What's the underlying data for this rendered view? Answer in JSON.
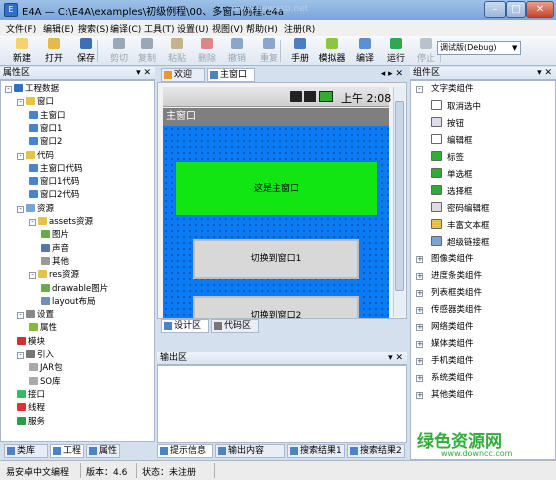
{
  "window": {
    "title": "E4A — C:\\E4A\\examples\\初级例程\\00、多窗口例程.e4a",
    "watermark": "www.newasp.net",
    "app_icon": "E"
  },
  "menu": [
    "文件(F)",
    "编辑(E)",
    "搜索(S)",
    "编译(C)",
    "工具(T)",
    "设置(U)",
    "视图(V)",
    "帮助(H)",
    "注册(R)"
  ],
  "toolbar": [
    {
      "label": "新建",
      "icon": "new-file-icon",
      "color": "#f5d26b",
      "enabled": true
    },
    {
      "label": "打开",
      "icon": "open-folder-icon",
      "color": "#e8b84a",
      "enabled": true
    },
    {
      "label": "保存",
      "icon": "save-icon",
      "color": "#3c6fb5",
      "enabled": true
    },
    {
      "label": "剪切",
      "icon": "cut-icon",
      "color": "#9aa7b8",
      "enabled": false
    },
    {
      "label": "复制",
      "icon": "copy-icon",
      "color": "#9aa7b8",
      "enabled": false
    },
    {
      "label": "粘贴",
      "icon": "paste-icon",
      "color": "#c7b28a",
      "enabled": false
    },
    {
      "label": "删除",
      "icon": "delete-icon",
      "color": "#d88",
      "enabled": false
    },
    {
      "label": "撤销",
      "icon": "undo-icon",
      "color": "#8aa6cf",
      "enabled": false
    },
    {
      "label": "重复",
      "icon": "redo-icon",
      "color": "#8aa6cf",
      "enabled": false
    },
    {
      "label": "手册",
      "icon": "manual-icon",
      "color": "#4a7fc2",
      "enabled": true
    },
    {
      "label": "模拟器",
      "icon": "android-icon",
      "color": "#8cc63f",
      "enabled": true
    },
    {
      "label": "编译",
      "icon": "compile-icon",
      "color": "#5b8fd6",
      "enabled": true
    },
    {
      "label": "运行",
      "icon": "run-icon",
      "color": "#2fa84f",
      "enabled": true
    },
    {
      "label": "停止",
      "icon": "stop-icon",
      "color": "#b9c2cc",
      "enabled": false
    }
  ],
  "debug_mode": "调试版(Debug)",
  "left_panel": {
    "title": "属性区",
    "tabs": [
      "类库",
      "工程",
      "属性"
    ]
  },
  "project_tree": [
    {
      "label": "工程数据",
      "level": 0,
      "icon": "project-icon",
      "exp": "-"
    },
    {
      "label": "窗口",
      "level": 1,
      "icon": "folder-icon",
      "exp": "-"
    },
    {
      "label": "主窗口",
      "level": 2,
      "icon": "window-icon",
      "exp": ""
    },
    {
      "label": "窗口1",
      "level": 2,
      "icon": "window-icon",
      "exp": ""
    },
    {
      "label": "窗口2",
      "level": 2,
      "icon": "window-icon",
      "exp": ""
    },
    {
      "label": "代码",
      "level": 1,
      "icon": "folder-icon",
      "exp": "-"
    },
    {
      "label": "主窗口代码",
      "level": 2,
      "icon": "code-icon",
      "exp": ""
    },
    {
      "label": "窗口1代码",
      "level": 2,
      "icon": "code-icon",
      "exp": ""
    },
    {
      "label": "窗口2代码",
      "level": 2,
      "icon": "code-icon",
      "exp": ""
    },
    {
      "label": "资源",
      "level": 1,
      "icon": "resource-icon",
      "exp": "-"
    },
    {
      "label": "assets资源",
      "level": 2,
      "icon": "folder-icon",
      "exp": "-"
    },
    {
      "label": "图片",
      "level": 3,
      "icon": "image-icon",
      "exp": ""
    },
    {
      "label": "声音",
      "level": 3,
      "icon": "sound-icon",
      "exp": ""
    },
    {
      "label": "其他",
      "level": 3,
      "icon": "other-icon",
      "exp": ""
    },
    {
      "label": "res资源",
      "level": 2,
      "icon": "folder-icon",
      "exp": "-"
    },
    {
      "label": "drawable图片",
      "level": 3,
      "icon": "image-icon",
      "exp": ""
    },
    {
      "label": "layout布局",
      "level": 3,
      "icon": "layout-icon",
      "exp": ""
    },
    {
      "label": "设置",
      "level": 1,
      "icon": "settings-icon",
      "exp": "-"
    },
    {
      "label": "属性",
      "level": 2,
      "icon": "property-icon",
      "exp": ""
    },
    {
      "label": "模块",
      "level": 1,
      "icon": "module-icon",
      "exp": ""
    },
    {
      "label": "引入",
      "level": 1,
      "icon": "import-icon",
      "exp": "-"
    },
    {
      "label": "JAR包",
      "level": 2,
      "icon": "jar-icon",
      "exp": ""
    },
    {
      "label": "SO库",
      "level": 2,
      "icon": "so-icon",
      "exp": ""
    },
    {
      "label": "接口",
      "level": 1,
      "icon": "interface-icon",
      "exp": ""
    },
    {
      "label": "线程",
      "level": 1,
      "icon": "thread-icon",
      "exp": ""
    },
    {
      "label": "服务",
      "level": 1,
      "icon": "service-icon",
      "exp": ""
    }
  ],
  "doc_tabs": [
    "欢迎",
    "主窗口"
  ],
  "phone": {
    "time": "上午 2:08",
    "window_title": "主窗口",
    "label_text": "这是主窗口",
    "btn1": "切换到窗口1",
    "btn2": "切换到窗口2"
  },
  "view_tabs": [
    "设计区",
    "代码区"
  ],
  "output": {
    "title": "输出区",
    "tabs": [
      "提示信息",
      "输出内容",
      "搜索结果1",
      "搜索结果2"
    ]
  },
  "right_panel": {
    "title": "组件区"
  },
  "component_groups": [
    {
      "label": "文字类组件",
      "open": true,
      "items": [
        {
          "label": "取消选中",
          "icon": "cursor-icon"
        },
        {
          "label": "按钮",
          "icon": "button-icon"
        },
        {
          "label": "编辑框",
          "icon": "editbox-icon"
        },
        {
          "label": "标签",
          "icon": "label-icon"
        },
        {
          "label": "单选框",
          "icon": "radio-icon"
        },
        {
          "label": "选择框",
          "icon": "checkbox-icon"
        },
        {
          "label": "密码编辑框",
          "icon": "password-icon"
        },
        {
          "label": "丰富文本框",
          "icon": "richtext-icon"
        },
        {
          "label": "超级链接框",
          "icon": "hyperlink-icon"
        }
      ]
    },
    {
      "label": "图像类组件",
      "open": false,
      "items": []
    },
    {
      "label": "进度条类组件",
      "open": false,
      "items": []
    },
    {
      "label": "列表框类组件",
      "open": false,
      "items": []
    },
    {
      "label": "传感器类组件",
      "open": false,
      "items": []
    },
    {
      "label": "网络类组件",
      "open": false,
      "items": []
    },
    {
      "label": "媒体类组件",
      "open": false,
      "items": []
    },
    {
      "label": "手机类组件",
      "open": false,
      "items": []
    },
    {
      "label": "系统类组件",
      "open": false,
      "items": []
    },
    {
      "label": "其他类组件",
      "open": false,
      "items": []
    }
  ],
  "status": {
    "app": "易安卓中文编程",
    "version": "版本：4.6",
    "state": "状态：未注册"
  },
  "brand": {
    "name": "绿色资源网",
    "url": "www.downcc.com"
  },
  "colors": {
    "phone_bg": "#0a7bf5",
    "label_green": "#12e612",
    "accent": "#2f6fc9"
  }
}
